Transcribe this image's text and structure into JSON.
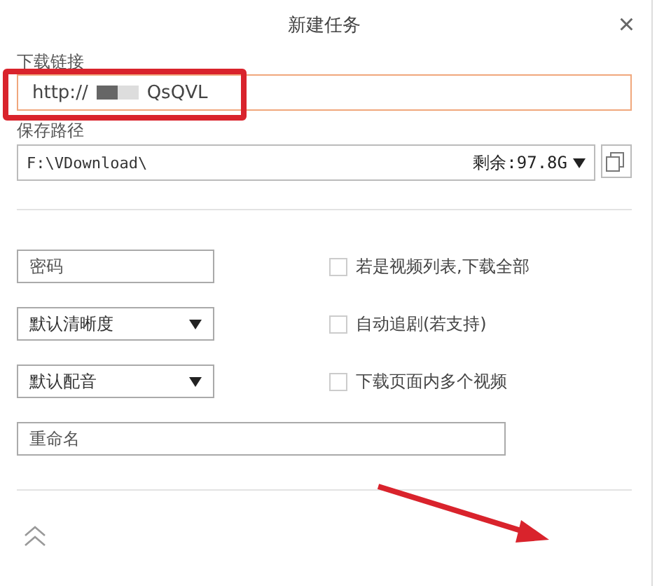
{
  "window": {
    "title": "新建任务",
    "close": "×"
  },
  "link": {
    "label": "下载链接",
    "value_start": "http://",
    "value_end": "QsQVL",
    "highlighted": true
  },
  "save_path": {
    "label": "保存路径",
    "value": "F:\\VDownload\\",
    "free_space": "剩余:97.8G"
  },
  "fields": [
    {
      "kind": "input",
      "placeholder": "密码"
    },
    {
      "kind": "select",
      "value": "默认清晰度"
    },
    {
      "kind": "select",
      "value": "默认配音"
    }
  ],
  "options": [
    {
      "label": "若是视频列表,下载全部",
      "checked": false
    },
    {
      "label": "自动追剧(若支持)",
      "checked": false
    },
    {
      "label": "下载页面内多个视频",
      "checked": false
    }
  ],
  "rename": {
    "placeholder": "重命名"
  }
}
